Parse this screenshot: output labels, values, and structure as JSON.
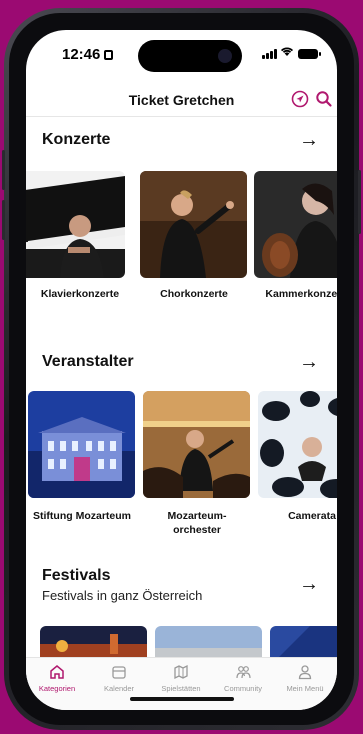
{
  "status": {
    "time": "12:46"
  },
  "header": {
    "title": "Ticket Gretchen",
    "location_icon": "location-arrow-icon",
    "search_icon": "search-icon"
  },
  "sections": {
    "konzerte": {
      "title": "Konzerte",
      "items": [
        {
          "label": "Klavierkonzerte"
        },
        {
          "label": "Chorkonzerte"
        },
        {
          "label": "Kammerkonzerte"
        }
      ]
    },
    "veranstalter": {
      "title": "Veranstalter",
      "items": [
        {
          "label": "Stiftung Mozarteum"
        },
        {
          "label": "Mozarteum-\norchester"
        },
        {
          "label": "Camerata"
        }
      ]
    },
    "festivals": {
      "title": "Festivals",
      "subtitle": "Festivals in ganz Österreich"
    }
  },
  "tabbar": {
    "items": [
      {
        "label": "Kategorien",
        "icon": "home-icon",
        "active": true
      },
      {
        "label": "Kalender",
        "icon": "calendar-icon",
        "active": false
      },
      {
        "label": "Spielstätten",
        "icon": "map-icon",
        "active": false
      },
      {
        "label": "Community",
        "icon": "people-icon",
        "active": false
      },
      {
        "label": "Mein Menü",
        "icon": "person-icon",
        "active": false
      }
    ]
  },
  "colors": {
    "accent": "#b0186e",
    "background": "#9b0a72"
  }
}
